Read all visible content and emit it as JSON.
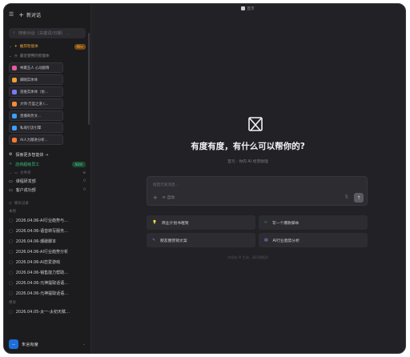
{
  "app": {
    "window_title": "首页",
    "new_chat_label": "新对话"
  },
  "sidebar": {
    "search_placeholder": "搜索对话（关键词/日期）…",
    "recommended_label": "推荐智能体",
    "recommended_badge": "99+",
    "recent_label": "最近使用的智能体",
    "agents": [
      {
        "label": "林黛玉人 心动剧情",
        "color": "#e85a9c"
      },
      {
        "label": "脚踏实体体",
        "color": "#f0a030"
      },
      {
        "label": "思维实体体（仿…",
        "color": "#7a7aff"
      },
      {
        "label": "大师·万里之道 (…",
        "color": "#ff8a30"
      },
      {
        "label": "直播商务文…",
        "color": "#3aa0ff"
      },
      {
        "label": "私域引流引擎",
        "color": "#3aa0ff"
      },
      {
        "label": "AI人力跟进分析…",
        "color": "#ff7a30"
      }
    ],
    "explore_label": "探索更多智能体 →",
    "workflow_label": "店商超级员工",
    "workflow_badge": "NEW",
    "files_label": "文件夹",
    "folders": [
      {
        "label": "课程研发部",
        "count": "0"
      },
      {
        "label": "客户成功部",
        "count": "0"
      }
    ],
    "history_label": "聊天记录",
    "history_sub": "本周",
    "history": [
      "2026.04.06-AI行业趋势与…",
      "2026.04.06-语音转写服务…",
      "2026.04.06-爆破脚本",
      "2026.04.06-AI行业趋势分析",
      "2026.04.06-AI恋爱游戏",
      "2026.04.06-销售能力帮助…",
      "2026.04.06-元神提取话语…",
      "2026.04.06-元神提取话语…"
    ],
    "history_sub2": "更早",
    "history2": [
      "2026.04.05-太一-太初天赋…"
    ],
    "user_name": "朱言有度"
  },
  "main": {
    "title": "有度有度，有什么可以帮你的?",
    "subtitle": "首元 · 你的 AI 经营助理",
    "input_placeholder": "给首元发消息…",
    "plus_label": "+",
    "auto_label": "自动",
    "quick_actions": [
      {
        "label": "商业计划书框架",
        "icon": "bulb-icon",
        "color": "#f0c040"
      },
      {
        "label": "写一个爆款脚本",
        "icon": "code-icon",
        "color": "#3ad0a0"
      },
      {
        "label": "朋友圈营销文案",
        "icon": "pen-icon",
        "color": "#6a8cff"
      },
      {
        "label": "AI行业趋势分析",
        "icon": "chart-icon",
        "color": "#b07aff"
      }
    ],
    "footer": "内容由 AI 生成，请仔细甄别"
  }
}
